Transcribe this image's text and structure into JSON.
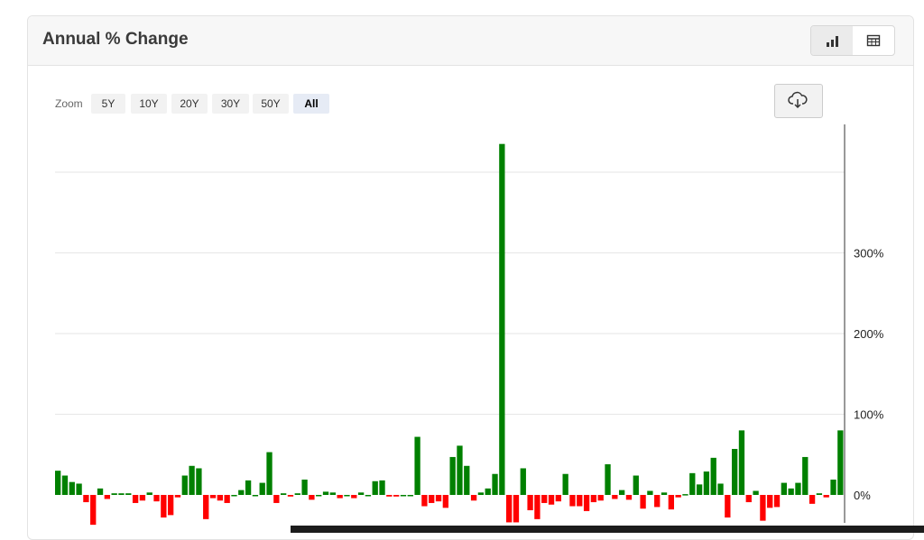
{
  "header": {
    "title": "Annual % Change"
  },
  "view_toggle": {
    "active": "chart",
    "icons": [
      "bar-chart-icon",
      "table-icon"
    ]
  },
  "zoom": {
    "label": "Zoom",
    "options": [
      "5Y",
      "10Y",
      "20Y",
      "30Y",
      "50Y",
      "All"
    ],
    "selected": "All"
  },
  "download": {
    "icon": "cloud-download-icon"
  },
  "colors": {
    "positive": "#008000",
    "negative": "#ff0000",
    "grid": "#e6e6e6",
    "axis": "#333333"
  },
  "chart_data": {
    "type": "bar",
    "title": "",
    "xlabel": "",
    "ylabel": "",
    "y_axis_position": "right",
    "y_ticks": [
      "0%",
      "100%",
      "200%",
      "300%"
    ],
    "ylim": [
      -37,
      435
    ],
    "grid": true,
    "values": [
      30,
      24,
      16,
      14,
      -9,
      -37,
      8,
      -5,
      2,
      2,
      2,
      -10,
      -7,
      3,
      -8,
      -28,
      -25,
      -3,
      24,
      36,
      33,
      -30,
      -4,
      -7,
      -10,
      0,
      6,
      18,
      0,
      15,
      53,
      -10,
      2,
      -2,
      2,
      19,
      -6,
      0,
      4,
      3,
      -4,
      0,
      -4,
      3,
      0,
      17,
      18,
      -2,
      -2,
      0,
      0,
      72,
      -14,
      -10,
      -8,
      -16,
      47,
      61,
      36,
      -7,
      3,
      8,
      26,
      435,
      -34,
      -34,
      33,
      -19,
      -30,
      -10,
      -12,
      -8,
      26,
      -14,
      -14,
      -20,
      -9,
      -7,
      38,
      -5,
      6,
      -6,
      24,
      -17,
      5,
      -15,
      3,
      -18,
      -3,
      1,
      27,
      13,
      29,
      46,
      14,
      -28,
      57,
      80,
      -9,
      5,
      -32,
      -16,
      -15,
      15,
      8,
      15,
      47,
      -11,
      2,
      -3,
      19,
      80
    ]
  }
}
